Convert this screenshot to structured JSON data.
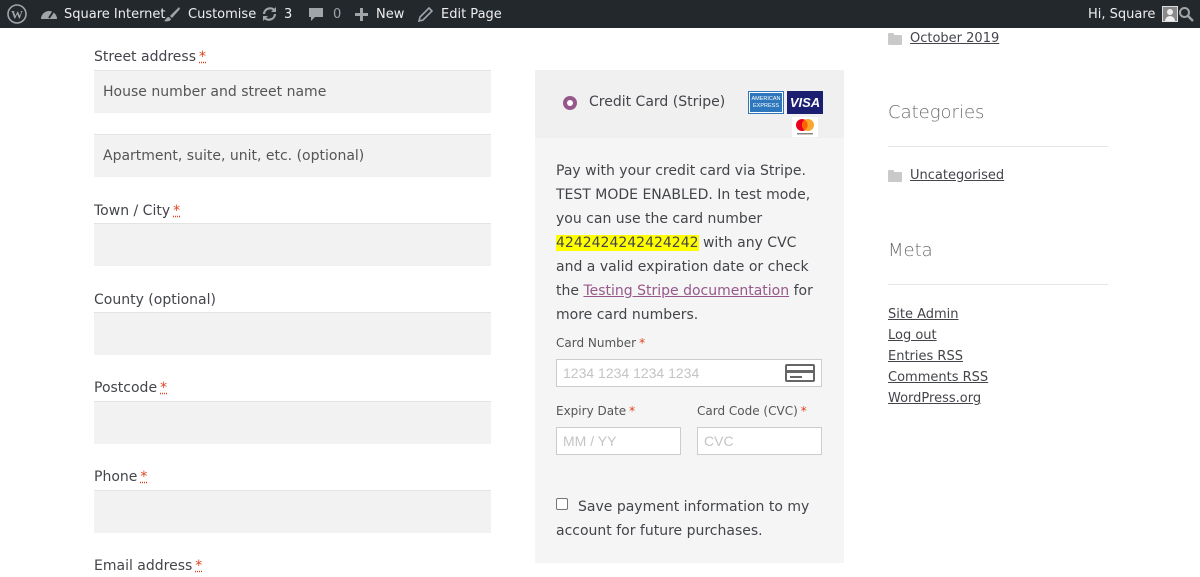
{
  "adminbar": {
    "site_name": "Square Internet",
    "customise": "Customise",
    "updates_count": "3",
    "comments_count": "0",
    "new": "New",
    "edit_page": "Edit Page",
    "greeting": "Hi, Square"
  },
  "form": {
    "street_label": "Street address",
    "street_placeholder": "House number and street name",
    "apartment_placeholder": "Apartment, suite, unit, etc. (optional)",
    "town_label": "Town / City",
    "county_label": "County (optional)",
    "postcode_label": "Postcode",
    "phone_label": "Phone",
    "email_label": "Email address",
    "required_mark": "*"
  },
  "payment": {
    "method_title": "Credit Card (Stripe)",
    "amex_text": "AMERICAN EXPRESS",
    "visa_text": "VISA",
    "desc_part1": "Pay with your credit card via Stripe. TEST MODE ENABLED. In test mode, you can use the card number ",
    "test_card": "4242424242424242",
    "desc_part2": " with any CVC and a valid expiration date or check the ",
    "doc_link": "Testing Stripe documentation",
    "desc_part3": " for more card numbers.",
    "card_number_label": "Card Number",
    "card_number_placeholder": "1234 1234 1234 1234",
    "expiry_label": "Expiry Date",
    "expiry_placeholder": "MM / YY",
    "cvc_label": "Card Code (CVC)",
    "cvc_placeholder": "CVC",
    "required_mark": "*",
    "save_text": "Save payment information to my account for future purchases."
  },
  "sidebar": {
    "archive_month": "October 2019",
    "categories_heading": "Categories",
    "category_item": "Uncategorised",
    "meta_heading": "Meta",
    "meta_links": [
      "Site Admin",
      "Log out",
      "Entries RSS",
      "Comments RSS",
      "WordPress.org"
    ]
  },
  "colors": {
    "adminbar_bg": "#23282d",
    "accent": "#96588a",
    "required": "#e2401c",
    "highlight": "#ffff00"
  }
}
